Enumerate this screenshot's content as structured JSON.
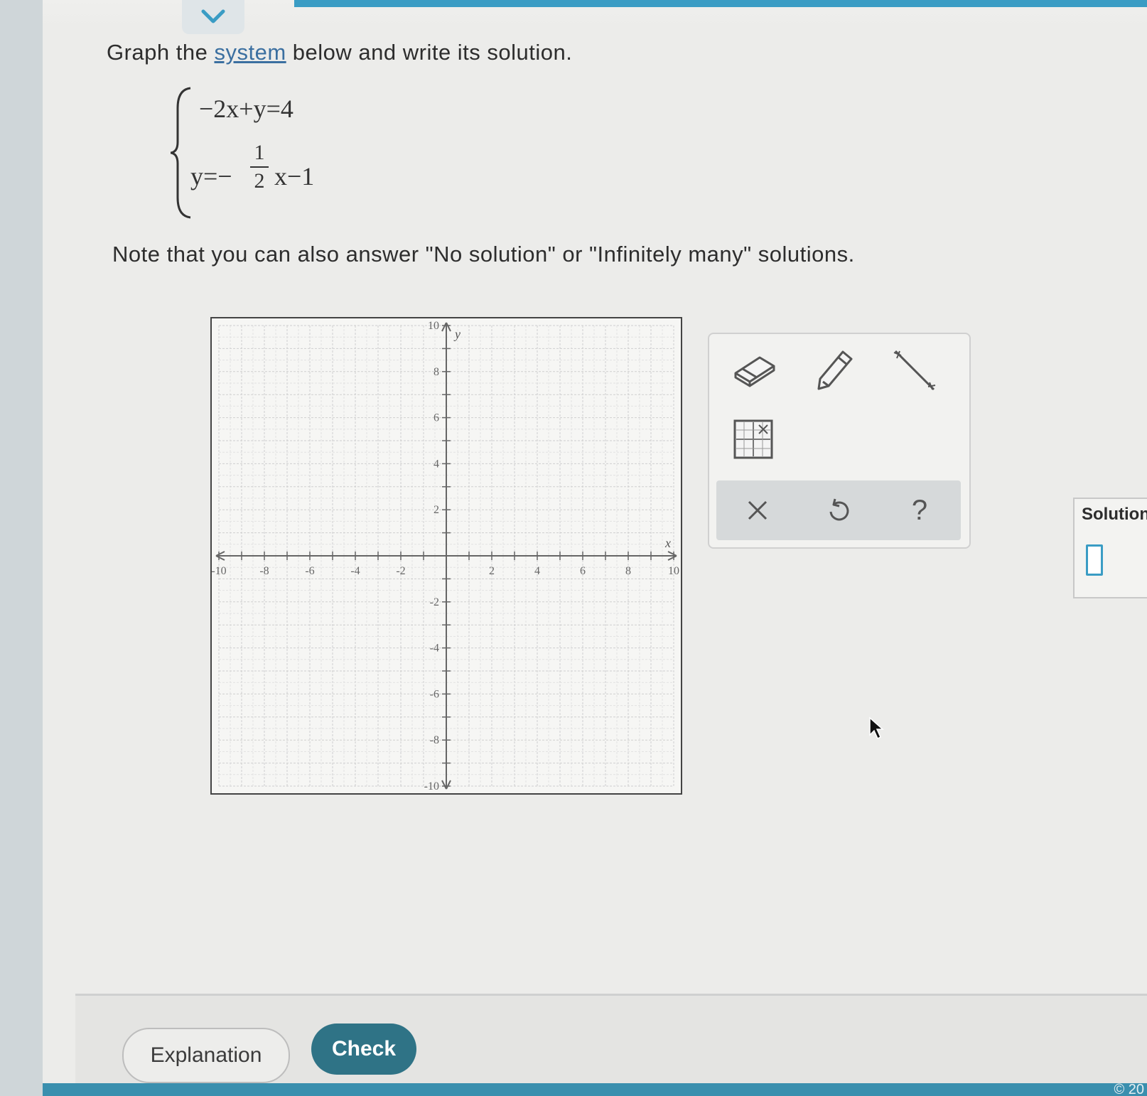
{
  "prompt": {
    "before_link": "Graph the ",
    "link_text": "system",
    "after_link": " below and write its solution."
  },
  "system": {
    "eq1": "−2x+y=4",
    "eq2_lhs": "y=−",
    "eq2_frac_num": "1",
    "eq2_frac_den": "2",
    "eq2_rhs": "x−1"
  },
  "note": "Note that you can also answer \"No solution\" or \"Infinitely many\" solutions.",
  "graph": {
    "x_axis_label": "x",
    "y_axis_label": "y",
    "x_ticks": [
      "-10",
      "-8",
      "-6",
      "-4",
      "-2",
      "2",
      "4",
      "6",
      "8",
      "10"
    ],
    "y_ticks": [
      "10",
      "8",
      "6",
      "4",
      "2",
      "-2",
      "-4",
      "-6",
      "-8",
      "-10"
    ],
    "range": {
      "xmin": -10,
      "xmax": 10,
      "ymin": -10,
      "ymax": 10
    }
  },
  "tools": {
    "items": [
      "eraser-icon",
      "pencil-icon",
      "line-segment-icon",
      "graph-grid-icon"
    ],
    "actions": [
      "close-icon",
      "undo-icon",
      "help-icon"
    ],
    "help_label": "?"
  },
  "solution": {
    "label": "Solution",
    "value": ""
  },
  "buttons": {
    "explanation": "Explanation",
    "check": "Check"
  },
  "footer": {
    "copyright": "© 20"
  },
  "colors": {
    "accent": "#3a9cc4",
    "check_button": "#2f7386",
    "link": "#3b6fa0"
  }
}
